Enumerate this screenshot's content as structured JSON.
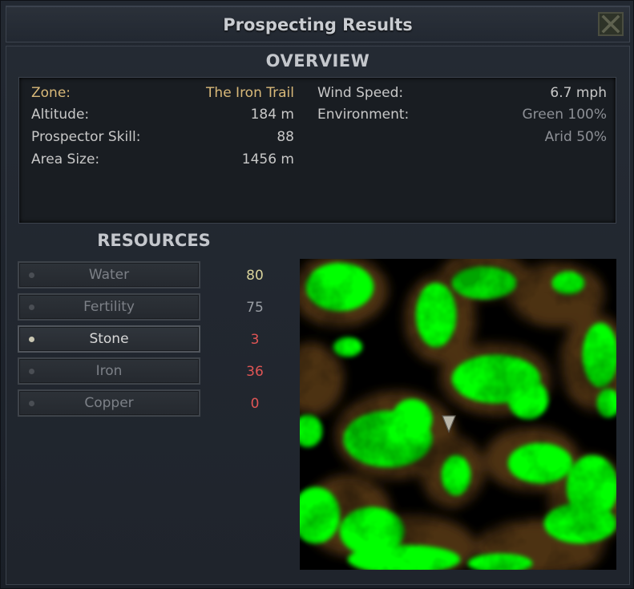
{
  "window": {
    "title": "Prospecting Results"
  },
  "overview": {
    "heading": "OVERVIEW",
    "zone_label": "Zone:",
    "zone_value": "The Iron Trail",
    "altitude_label": "Altitude:",
    "altitude_value": "184 m",
    "skill_label": "Prospector Skill:",
    "skill_value": "88",
    "area_label": "Area Size:",
    "area_value": "1456 m",
    "wind_label": "Wind Speed:",
    "wind_value": "6.7 mph",
    "env_label": "Environment:",
    "env_values": [
      "Green 100%",
      "Arid 50%"
    ]
  },
  "resources": {
    "heading": "RESOURCES",
    "selected": "Stone",
    "items": [
      {
        "label": "Water",
        "value": "80",
        "value_color": "#d8d29a"
      },
      {
        "label": "Fertility",
        "value": "75",
        "value_color": "#9a9ea4"
      },
      {
        "label": "Stone",
        "value": "3",
        "value_color": "#e05555"
      },
      {
        "label": "Iron",
        "value": "36",
        "value_color": "#e05555"
      },
      {
        "label": "Copper",
        "value": "0",
        "value_color": "#e05555"
      }
    ]
  },
  "map": {
    "legend_color": "#00ff00",
    "marker_icon": "triangle-marker-icon"
  }
}
